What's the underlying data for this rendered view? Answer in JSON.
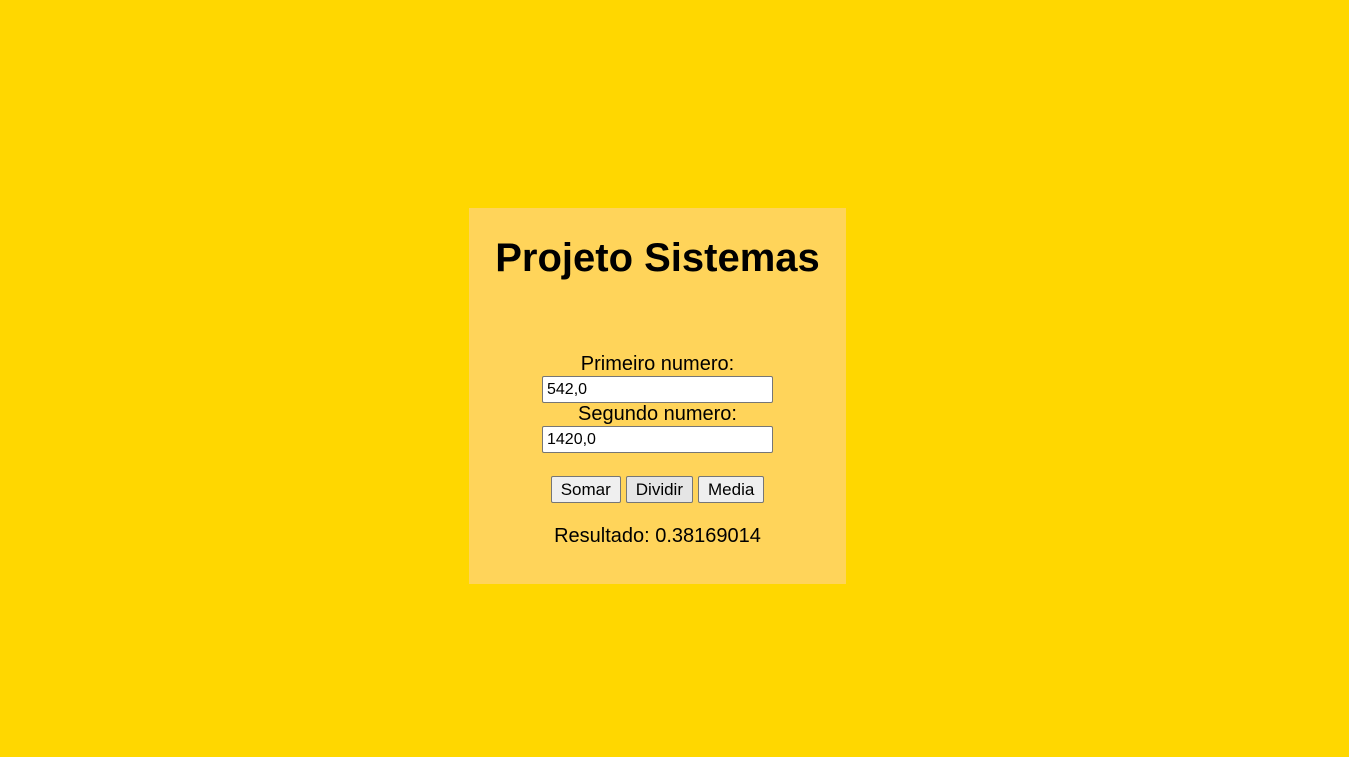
{
  "header": {
    "title": "Projeto Sistemas"
  },
  "form": {
    "first_label": "Primeiro numero:",
    "first_value": "542,0",
    "second_label": "Segundo numero:",
    "second_value": "1420,0"
  },
  "actions": {
    "sum_label": "Somar",
    "divide_label": "Dividir",
    "mean_label": "Media"
  },
  "result": {
    "text": "Resultado: 0.38169014"
  },
  "colors": {
    "background": "#FFD700",
    "card": "#FFD45A"
  }
}
